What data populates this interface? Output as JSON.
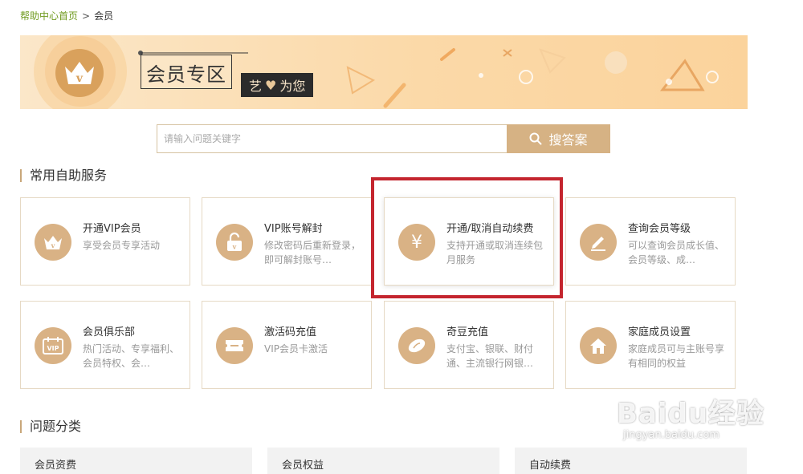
{
  "breadcrumb": {
    "home": "帮助中心首页",
    "separator": ">",
    "current": "会员"
  },
  "banner": {
    "title": "会员专区",
    "slogan_left": "艺",
    "slogan_right": "为您",
    "crown_letter": "v"
  },
  "search": {
    "placeholder": "请输入问题关键字",
    "button_label": "搜答案"
  },
  "sections": {
    "self_service": "常用自助服务",
    "categories": "问题分类"
  },
  "services": [
    {
      "title": "开通VIP会员",
      "desc": "享受会员专享活动",
      "icon": "crown-icon"
    },
    {
      "title": "VIP账号解封",
      "desc": "修改密码后重新登录，即可解封账号…",
      "icon": "unlock-icon"
    },
    {
      "title": "开通/取消自动续费",
      "desc": "支持开通或取消连续包月服务",
      "icon": "yen-icon"
    },
    {
      "title": "查询会员等级",
      "desc": "可以查询会员成长值、会员等级、成…",
      "icon": "pencil-icon"
    },
    {
      "title": "会员俱乐部",
      "desc": "热门活动、专享福利、会员特权、会…",
      "icon": "vip-calendar-icon"
    },
    {
      "title": "激活码充值",
      "desc": "VIP会员卡激活",
      "icon": "ticket-icon"
    },
    {
      "title": "奇豆充值",
      "desc": "支付宝、银联、财付通、主流银行网银…",
      "icon": "bean-icon"
    },
    {
      "title": "家庭成员设置",
      "desc": "家庭成员可与主账号享有相同的权益",
      "icon": "home-icon"
    }
  ],
  "category_tabs": [
    "会员资费",
    "会员权益",
    "自动续费"
  ],
  "watermark": {
    "logo": "Baidu经验",
    "url": "jingyan.baidu.com"
  },
  "colors": {
    "accent": "#d9b285",
    "banner": "#fbd9a8",
    "highlight": "#c4252e",
    "link": "#6f9a1e"
  }
}
